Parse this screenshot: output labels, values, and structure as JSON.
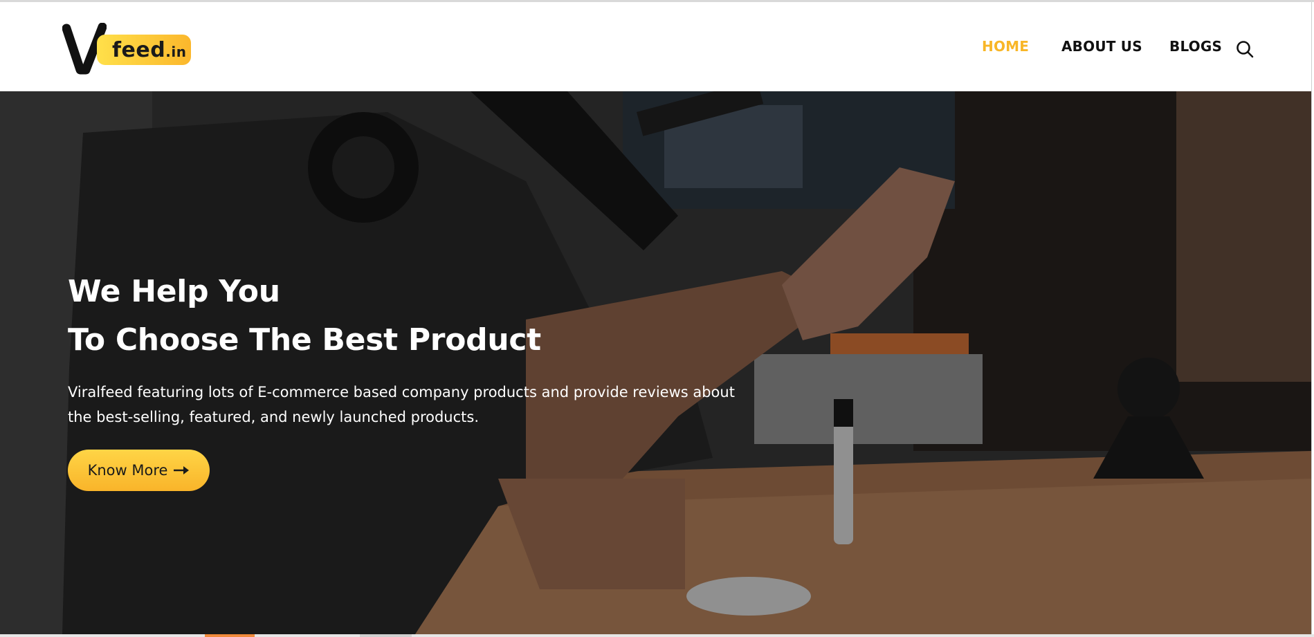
{
  "brand": {
    "logo_letter": "V",
    "logo_name": "feed",
    "logo_suffix": ".in"
  },
  "nav": {
    "items": [
      {
        "label": "HOME",
        "active": true
      },
      {
        "label": "ABOUT US",
        "active": false
      },
      {
        "label": "BLOGS",
        "active": false
      }
    ],
    "search_icon": "search-icon"
  },
  "hero": {
    "title_line1": "We Help You",
    "title_line2": "To Choose The Best Product",
    "description_line1": "Viralfeed featuring lots of E-commerce based company products and provide reviews about",
    "description_line2": "the best-selling, featured, and newly launched products.",
    "cta_label": "Know More",
    "cta_icon": "arrow-right-icon"
  },
  "colors": {
    "accent": "#f8b627",
    "nav_text": "#111111",
    "hero_text": "#ffffff"
  }
}
